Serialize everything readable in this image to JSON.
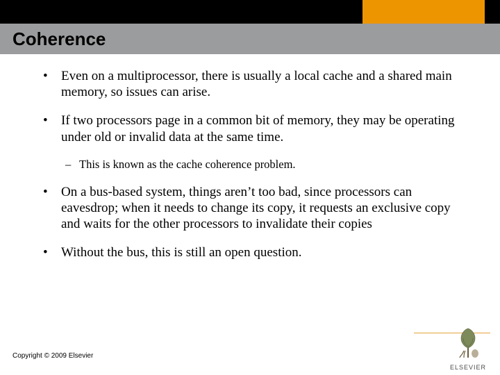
{
  "header": {
    "title": "Coherence"
  },
  "bullets": [
    {
      "text": "Even on a multiprocessor, there is usually a local cache and a shared main memory, so issues can arise."
    },
    {
      "text": "If two processors page in a common bit of memory, they may be operating under old or invalid data at the same time.",
      "sub": [
        {
          "text": "This is known as the cache coherence problem."
        }
      ]
    },
    {
      "text": "On a bus-based system, things aren’t too bad, since processors can eavesdrop; when it needs to change its copy, it requests an exclusive copy and waits for the other processors to invalidate their copies"
    },
    {
      "text": "Without the bus, this is still an open question."
    }
  ],
  "footer": {
    "copyright": "Copyright © 2009 Elsevier",
    "publisher": "ELSEVIER"
  },
  "glyphs": {
    "bullet": "•",
    "dash": "–"
  }
}
